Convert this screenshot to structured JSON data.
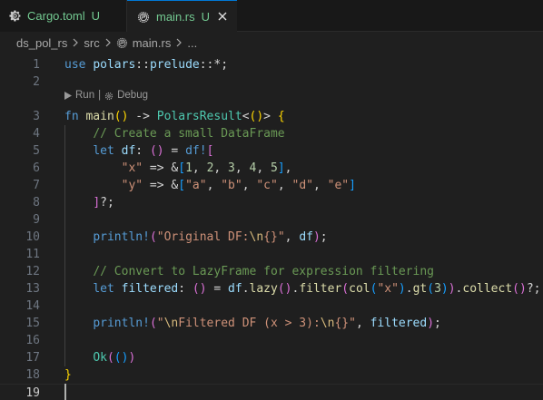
{
  "tabs": [
    {
      "label": "Cargo.toml",
      "status": "U",
      "icon": "gear-icon"
    },
    {
      "label": "main.rs",
      "status": "U",
      "icon": "rust-icon",
      "close": "×"
    }
  ],
  "breadcrumb": {
    "items": [
      "ds_pol_rs",
      "src",
      "main.rs",
      "..."
    ],
    "separator": ">"
  },
  "codelens": {
    "run": "Run",
    "sep": "|",
    "debug": "Debug"
  },
  "editor": {
    "current_line": 19,
    "lines": [
      {
        "n": "1",
        "tokens": [
          [
            "kw",
            "use"
          ],
          [
            "pl",
            " "
          ],
          [
            "id",
            "polars"
          ],
          [
            "pl",
            "::"
          ],
          [
            "id",
            "prelude"
          ],
          [
            "pl",
            "::*;"
          ]
        ]
      },
      {
        "n": "2",
        "tokens": []
      },
      {
        "n": "3",
        "tokens": [
          [
            "kw",
            "fn"
          ],
          [
            "pl",
            " "
          ],
          [
            "fn",
            "main"
          ],
          [
            "b1",
            "()"
          ],
          [
            "pl",
            " -> "
          ],
          [
            "ty",
            "PolarsResult"
          ],
          [
            "pl",
            "<"
          ],
          [
            "b1",
            "()"
          ],
          [
            "pl",
            "> "
          ],
          [
            "b1",
            "{"
          ]
        ]
      },
      {
        "n": "4",
        "tokens": [
          [
            "pl",
            "    "
          ],
          [
            "cm",
            "// Create a small DataFrame"
          ]
        ]
      },
      {
        "n": "5",
        "tokens": [
          [
            "pl",
            "    "
          ],
          [
            "kw",
            "let"
          ],
          [
            "pl",
            " "
          ],
          [
            "id",
            "df"
          ],
          [
            "pl",
            ": "
          ],
          [
            "b2",
            "()"
          ],
          [
            "pl",
            " = "
          ],
          [
            "ma",
            "df!"
          ],
          [
            "b2",
            "["
          ]
        ]
      },
      {
        "n": "6",
        "tokens": [
          [
            "pl",
            "        "
          ],
          [
            "st",
            "\"x\""
          ],
          [
            "pl",
            " => &"
          ],
          [
            "b3",
            "["
          ],
          [
            "nu",
            "1"
          ],
          [
            "pl",
            ", "
          ],
          [
            "nu",
            "2"
          ],
          [
            "pl",
            ", "
          ],
          [
            "nu",
            "3"
          ],
          [
            "pl",
            ", "
          ],
          [
            "nu",
            "4"
          ],
          [
            "pl",
            ", "
          ],
          [
            "nu",
            "5"
          ],
          [
            "b3",
            "]"
          ],
          [
            "pl",
            ","
          ]
        ]
      },
      {
        "n": "7",
        "tokens": [
          [
            "pl",
            "        "
          ],
          [
            "st",
            "\"y\""
          ],
          [
            "pl",
            " => &"
          ],
          [
            "b3",
            "["
          ],
          [
            "st",
            "\"a\""
          ],
          [
            "pl",
            ", "
          ],
          [
            "st",
            "\"b\""
          ],
          [
            "pl",
            ", "
          ],
          [
            "st",
            "\"c\""
          ],
          [
            "pl",
            ", "
          ],
          [
            "st",
            "\"d\""
          ],
          [
            "pl",
            ", "
          ],
          [
            "st",
            "\"e\""
          ],
          [
            "b3",
            "]"
          ]
        ]
      },
      {
        "n": "8",
        "tokens": [
          [
            "pl",
            "    "
          ],
          [
            "b2",
            "]"
          ],
          [
            "pl",
            "?;"
          ]
        ]
      },
      {
        "n": "9",
        "tokens": []
      },
      {
        "n": "10",
        "tokens": [
          [
            "pl",
            "    "
          ],
          [
            "ma",
            "println!"
          ],
          [
            "b2",
            "("
          ],
          [
            "st",
            "\"Original DF:"
          ],
          [
            "esc",
            "\\n"
          ],
          [
            "st",
            "{}\""
          ],
          [
            "pl",
            ", "
          ],
          [
            "id",
            "df"
          ],
          [
            "b2",
            ")"
          ],
          [
            "pl",
            ";"
          ]
        ]
      },
      {
        "n": "11",
        "tokens": []
      },
      {
        "n": "12",
        "tokens": [
          [
            "pl",
            "    "
          ],
          [
            "cm",
            "// Convert to LazyFrame for expression filtering"
          ]
        ]
      },
      {
        "n": "13",
        "tokens": [
          [
            "pl",
            "    "
          ],
          [
            "kw",
            "let"
          ],
          [
            "pl",
            " "
          ],
          [
            "id",
            "filtered"
          ],
          [
            "pl",
            ": "
          ],
          [
            "b2",
            "()"
          ],
          [
            "pl",
            " = "
          ],
          [
            "id",
            "df"
          ],
          [
            "pl",
            "."
          ],
          [
            "fn",
            "lazy"
          ],
          [
            "b2",
            "()"
          ],
          [
            "pl",
            "."
          ],
          [
            "fn",
            "filter"
          ],
          [
            "b2",
            "("
          ],
          [
            "fn",
            "col"
          ],
          [
            "b3",
            "("
          ],
          [
            "st",
            "\"x\""
          ],
          [
            "b3",
            ")"
          ],
          [
            "pl",
            "."
          ],
          [
            "fn",
            "gt"
          ],
          [
            "b3",
            "("
          ],
          [
            "nu",
            "3"
          ],
          [
            "b3",
            ")"
          ],
          [
            "b2",
            ")"
          ],
          [
            "pl",
            "."
          ],
          [
            "fn",
            "collect"
          ],
          [
            "b2",
            "()"
          ],
          [
            "pl",
            "?;"
          ]
        ]
      },
      {
        "n": "14",
        "tokens": []
      },
      {
        "n": "15",
        "tokens": [
          [
            "pl",
            "    "
          ],
          [
            "ma",
            "println!"
          ],
          [
            "b2",
            "("
          ],
          [
            "st",
            "\""
          ],
          [
            "esc",
            "\\n"
          ],
          [
            "st",
            "Filtered DF (x > 3):"
          ],
          [
            "esc",
            "\\n"
          ],
          [
            "st",
            "{}\""
          ],
          [
            "pl",
            ", "
          ],
          [
            "id",
            "filtered"
          ],
          [
            "b2",
            ")"
          ],
          [
            "pl",
            ";"
          ]
        ]
      },
      {
        "n": "16",
        "tokens": []
      },
      {
        "n": "17",
        "tokens": [
          [
            "pl",
            "    "
          ],
          [
            "ty",
            "Ok"
          ],
          [
            "b2",
            "("
          ],
          [
            "b3",
            "()"
          ],
          [
            "b2",
            ")"
          ]
        ]
      },
      {
        "n": "18",
        "tokens": [
          [
            "b1",
            "}"
          ]
        ]
      },
      {
        "n": "19",
        "tokens": []
      }
    ]
  },
  "colors": {
    "accent": "#0078d4",
    "untracked": "#73c991",
    "background": "#1f1f1f"
  }
}
